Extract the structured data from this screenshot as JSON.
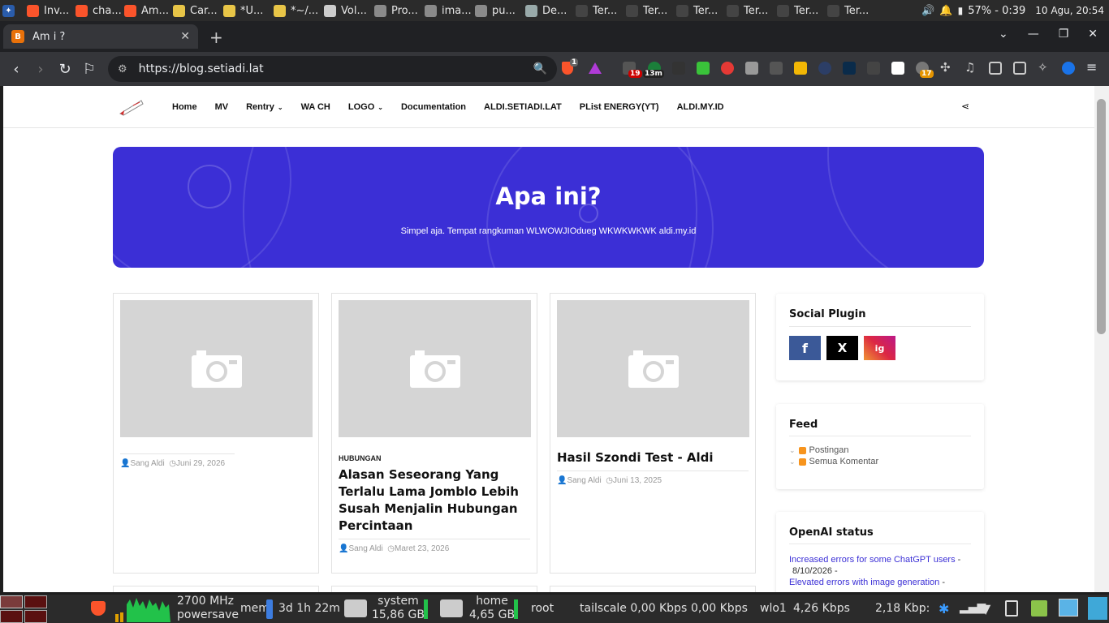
{
  "system_panel": {
    "tasks": [
      {
        "label": "Inv...",
        "icon": "brave-icon",
        "color": "#fb542b"
      },
      {
        "label": "cha...",
        "icon": "brave-icon",
        "color": "#fb542b"
      },
      {
        "label": "Am...",
        "icon": "brave-icon",
        "color": "#fb542b"
      },
      {
        "label": "Car...",
        "icon": "text-editor-icon",
        "color": "#e8c547"
      },
      {
        "label": "*U...",
        "icon": "text-editor-icon",
        "color": "#e8c547"
      },
      {
        "label": "*~/...",
        "icon": "text-editor-icon",
        "color": "#e8c547"
      },
      {
        "label": "Vol...",
        "icon": "volume-app-icon",
        "color": "#cccccc"
      },
      {
        "label": "Pro...",
        "icon": "folder-icon",
        "color": "#8a8a8a"
      },
      {
        "label": "ima...",
        "icon": "folder-icon",
        "color": "#8a8a8a"
      },
      {
        "label": "pu...",
        "icon": "folder-icon",
        "color": "#8a8a8a"
      },
      {
        "label": "De...",
        "icon": "device-icon",
        "color": "#9aa"
      },
      {
        "label": "Ter...",
        "icon": "terminal-icon",
        "color": "#444"
      },
      {
        "label": "Ter...",
        "icon": "terminal-icon",
        "color": "#444"
      },
      {
        "label": "Ter...",
        "icon": "terminal-icon",
        "color": "#444"
      },
      {
        "label": "Ter...",
        "icon": "terminal-icon",
        "color": "#444"
      },
      {
        "label": "Ter...",
        "icon": "terminal-icon",
        "color": "#444"
      },
      {
        "label": "Ter...",
        "icon": "terminal-icon",
        "color": "#444"
      }
    ],
    "battery": "57% - 0:39",
    "clock": "10 Agu, 20:54"
  },
  "browser": {
    "tab_title": "Am i ?",
    "new_tab": "+",
    "url": "https://blog.setiadi.lat",
    "brave_shield_count": "1",
    "ext_badge_a": "19",
    "ext_badge_b": "13m",
    "ext_badge_c": "17",
    "accent": "#fb542b"
  },
  "site": {
    "menu": [
      {
        "label": "Home"
      },
      {
        "label": "MV"
      },
      {
        "label": "Rentry",
        "dropdown": true
      },
      {
        "label": "WA CH"
      },
      {
        "label": "LOGO",
        "dropdown": true
      },
      {
        "label": "Documentation"
      },
      {
        "label": "ALDI.SETIADI.LAT"
      },
      {
        "label": "PList ENERGY(YT)"
      },
      {
        "label": "ALDI.MY.ID"
      }
    ],
    "hero": {
      "title": "Apa ini?",
      "subtitle": "Simpel aja. Tempat rangkuman WLWOWJIOdueg WKWKWKWK aldi.my.id",
      "color": "#3b2fd6"
    },
    "posts": [
      {
        "category": "",
        "title": "",
        "author": "Sang Aldi",
        "date": "Juni 29, 2026"
      },
      {
        "category": "HUBUNGAN",
        "title": "Alasan Seseorang Yang Terlalu Lama Jomblo Lebih Susah Menjalin Hubungan Percintaan",
        "author": "Sang Aldi",
        "date": "Maret 23, 2026"
      },
      {
        "category": "",
        "title": "Hasil Szondi Test - Aldi",
        "author": "Sang Aldi",
        "date": "Juni 13, 2025"
      }
    ],
    "widgets": {
      "social": {
        "title": "Social Plugin",
        "facebook": "f",
        "x": "X",
        "instagram": "ig"
      },
      "feed": {
        "title": "Feed",
        "items": [
          "Postingan",
          "Semua Komentar"
        ]
      },
      "openai": {
        "title": "OpenAI status",
        "items": [
          {
            "text": "Increased errors for some ChatGPT users",
            "suffix": " -",
            "date": "8/10/2026 -"
          },
          {
            "text": "Elevated errors with image generation",
            "suffix": " -",
            "date": ""
          }
        ]
      }
    }
  },
  "bottom_panel": {
    "cpu_freq": "2700 MHz",
    "cpu_gov": "powersave",
    "mem": "mem",
    "uptime": "3d 1h 22m",
    "system_label": "system",
    "system_size": "15,86 GB",
    "home_label": "home",
    "home_size": "4,65 GB",
    "root": "root",
    "tailscale": "tailscale 0,00 Kbps",
    "net2": "0,00 Kbps",
    "wlo1": "wlo1",
    "wlo1_down": "4,26 Kbps",
    "wlo1_up": "2,18 Kbp:"
  }
}
